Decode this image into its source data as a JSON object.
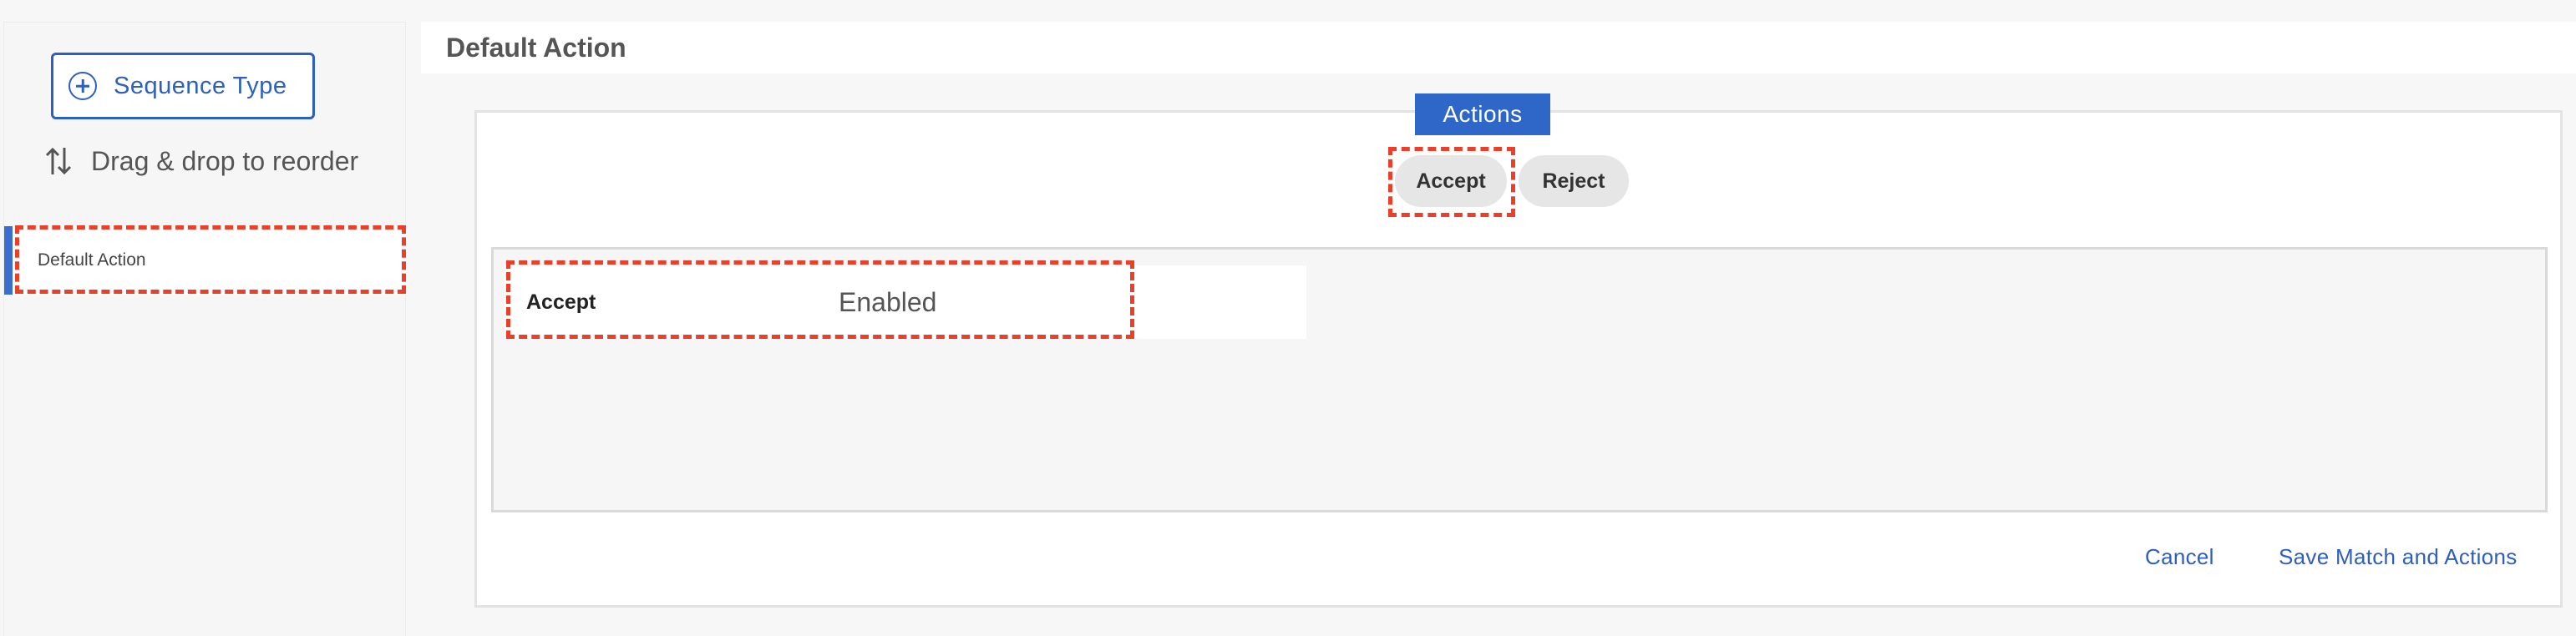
{
  "sidebar": {
    "sequence_button_label": "Sequence Type",
    "drag_hint": "Drag & drop to reorder",
    "items": [
      {
        "label": "Default Action"
      }
    ]
  },
  "header": {
    "title": "Default Action"
  },
  "actions": {
    "tab_label": "Actions",
    "options": [
      {
        "label": "Accept"
      },
      {
        "label": "Reject"
      }
    ],
    "rows": [
      {
        "name": "Accept",
        "value": "Enabled"
      }
    ]
  },
  "footer": {
    "cancel_label": "Cancel",
    "save_label": "Save Match and Actions"
  },
  "colors": {
    "accent": "#2f67c8",
    "highlight": "#e8402a"
  }
}
